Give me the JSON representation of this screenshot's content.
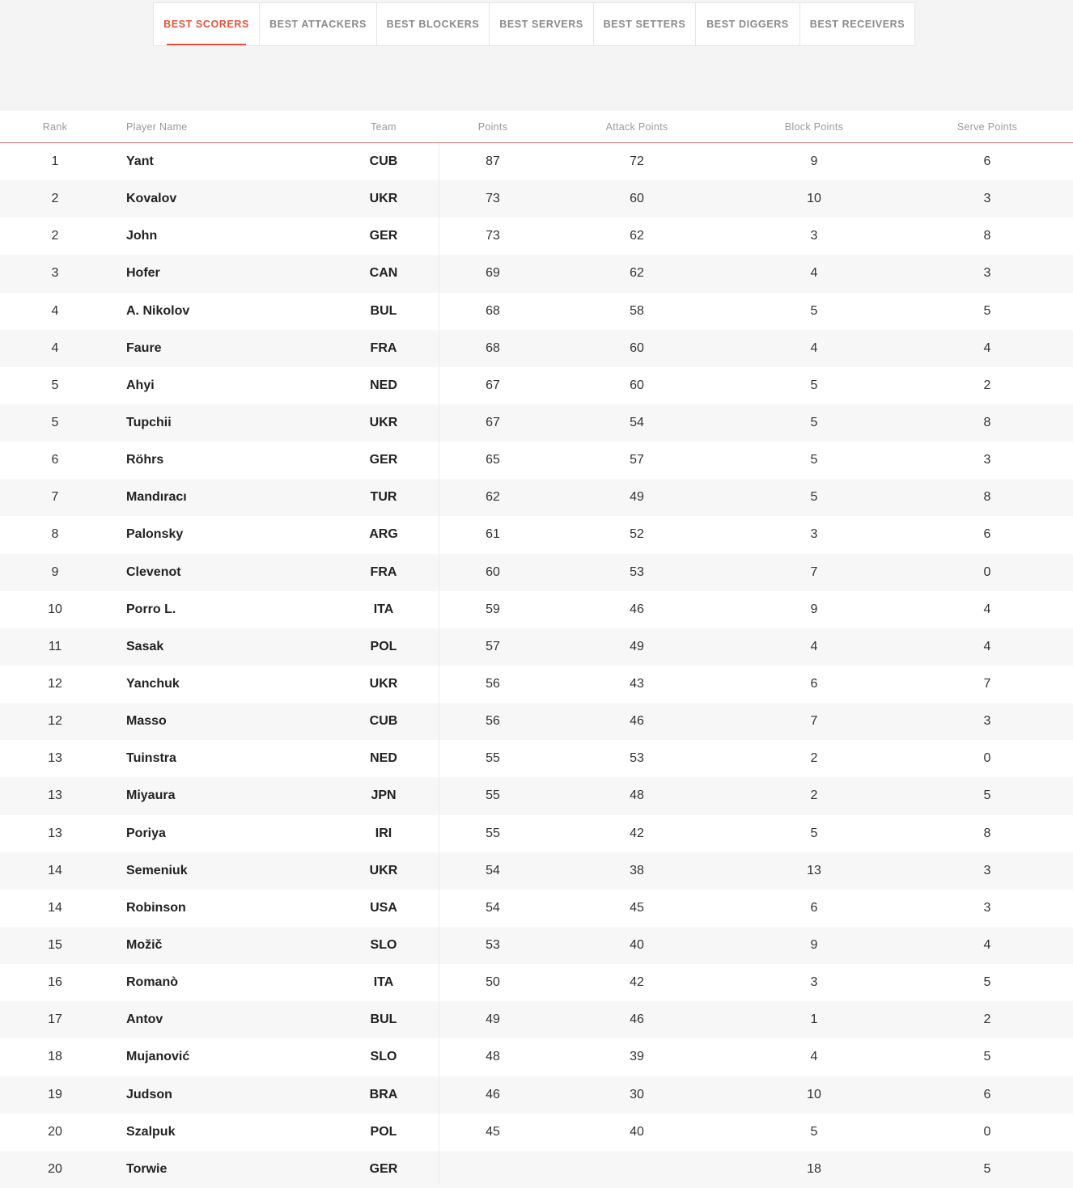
{
  "tabs": [
    {
      "label": "BEST SCORERS",
      "active": true
    },
    {
      "label": "BEST ATTACKERS",
      "active": false
    },
    {
      "label": "BEST BLOCKERS",
      "active": false
    },
    {
      "label": "BEST SERVERS",
      "active": false
    },
    {
      "label": "BEST SETTERS",
      "active": false
    },
    {
      "label": "BEST DIGGERS",
      "active": false
    },
    {
      "label": "BEST RECEIVERS",
      "active": false
    }
  ],
  "accent_color": "#e5533c",
  "table": {
    "headers": {
      "rank": "Rank",
      "name": "Player Name",
      "team": "Team",
      "points": "Points",
      "attack": "Attack Points",
      "block": "Block Points",
      "serve": "Serve Points"
    },
    "rows": [
      {
        "rank": "1",
        "name": "Yant",
        "team": "CUB",
        "points": "87",
        "attack": "72",
        "block": "9",
        "serve": "6"
      },
      {
        "rank": "2",
        "name": "Kovalov",
        "team": "UKR",
        "points": "73",
        "attack": "60",
        "block": "10",
        "serve": "3"
      },
      {
        "rank": "2",
        "name": "John",
        "team": "GER",
        "points": "73",
        "attack": "62",
        "block": "3",
        "serve": "8"
      },
      {
        "rank": "3",
        "name": "Hofer",
        "team": "CAN",
        "points": "69",
        "attack": "62",
        "block": "4",
        "serve": "3"
      },
      {
        "rank": "4",
        "name": "A. Nikolov",
        "team": "BUL",
        "points": "68",
        "attack": "58",
        "block": "5",
        "serve": "5"
      },
      {
        "rank": "4",
        "name": "Faure",
        "team": "FRA",
        "points": "68",
        "attack": "60",
        "block": "4",
        "serve": "4"
      },
      {
        "rank": "5",
        "name": "Ahyi",
        "team": "NED",
        "points": "67",
        "attack": "60",
        "block": "5",
        "serve": "2"
      },
      {
        "rank": "5",
        "name": "Tupchii",
        "team": "UKR",
        "points": "67",
        "attack": "54",
        "block": "5",
        "serve": "8"
      },
      {
        "rank": "6",
        "name": "Röhrs",
        "team": "GER",
        "points": "65",
        "attack": "57",
        "block": "5",
        "serve": "3"
      },
      {
        "rank": "7",
        "name": "Mandıracı",
        "team": "TUR",
        "points": "62",
        "attack": "49",
        "block": "5",
        "serve": "8"
      },
      {
        "rank": "8",
        "name": "Palonsky",
        "team": "ARG",
        "points": "61",
        "attack": "52",
        "block": "3",
        "serve": "6"
      },
      {
        "rank": "9",
        "name": "Clevenot",
        "team": "FRA",
        "points": "60",
        "attack": "53",
        "block": "7",
        "serve": "0"
      },
      {
        "rank": "10",
        "name": "Porro L.",
        "team": "ITA",
        "points": "59",
        "attack": "46",
        "block": "9",
        "serve": "4"
      },
      {
        "rank": "11",
        "name": "Sasak",
        "team": "POL",
        "points": "57",
        "attack": "49",
        "block": "4",
        "serve": "4"
      },
      {
        "rank": "12",
        "name": "Yanchuk",
        "team": "UKR",
        "points": "56",
        "attack": "43",
        "block": "6",
        "serve": "7"
      },
      {
        "rank": "12",
        "name": "Masso",
        "team": "CUB",
        "points": "56",
        "attack": "46",
        "block": "7",
        "serve": "3"
      },
      {
        "rank": "13",
        "name": "Tuinstra",
        "team": "NED",
        "points": "55",
        "attack": "53",
        "block": "2",
        "serve": "0"
      },
      {
        "rank": "13",
        "name": "Miyaura",
        "team": "JPN",
        "points": "55",
        "attack": "48",
        "block": "2",
        "serve": "5"
      },
      {
        "rank": "13",
        "name": "Poriya",
        "team": "IRI",
        "points": "55",
        "attack": "42",
        "block": "5",
        "serve": "8"
      },
      {
        "rank": "14",
        "name": "Semeniuk",
        "team": "UKR",
        "points": "54",
        "attack": "38",
        "block": "13",
        "serve": "3"
      },
      {
        "rank": "14",
        "name": "Robinson",
        "team": "USA",
        "points": "54",
        "attack": "45",
        "block": "6",
        "serve": "3"
      },
      {
        "rank": "15",
        "name": "Možič",
        "team": "SLO",
        "points": "53",
        "attack": "40",
        "block": "9",
        "serve": "4"
      },
      {
        "rank": "16",
        "name": "Romanò",
        "team": "ITA",
        "points": "50",
        "attack": "42",
        "block": "3",
        "serve": "5"
      },
      {
        "rank": "17",
        "name": "Antov",
        "team": "BUL",
        "points": "49",
        "attack": "46",
        "block": "1",
        "serve": "2"
      },
      {
        "rank": "18",
        "name": "Mujanović",
        "team": "SLO",
        "points": "48",
        "attack": "39",
        "block": "4",
        "serve": "5"
      },
      {
        "rank": "19",
        "name": "Judson",
        "team": "BRA",
        "points": "46",
        "attack": "30",
        "block": "10",
        "serve": "6"
      },
      {
        "rank": "20",
        "name": "Szalpuk",
        "team": "POL",
        "points": "45",
        "attack": "40",
        "block": "5",
        "serve": "0"
      },
      {
        "rank": "20",
        "name": "Torwie",
        "team": "GER",
        "points": "",
        "attack": "",
        "block": "18",
        "serve": "5"
      }
    ]
  }
}
